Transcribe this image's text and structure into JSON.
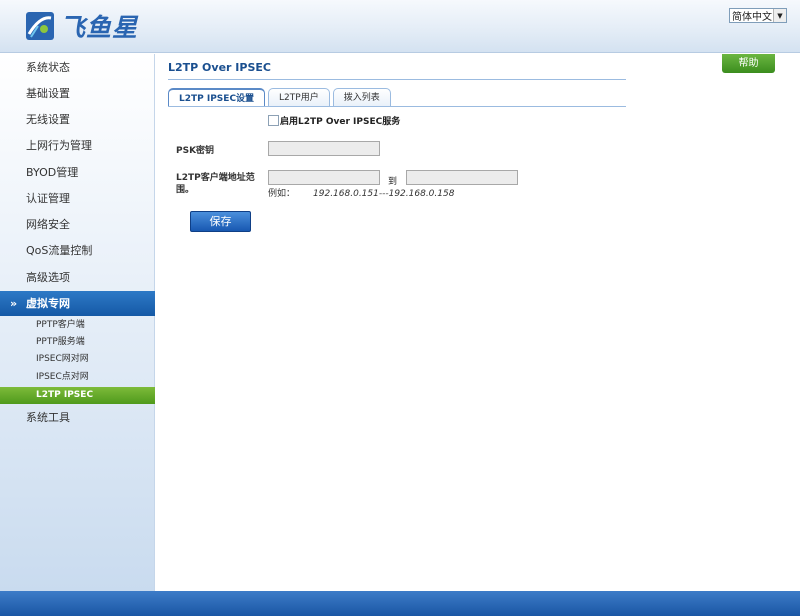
{
  "header": {
    "brand": "飞鱼星",
    "language": "简体中文"
  },
  "sidebar": {
    "items_top": [
      {
        "label": "系统状态"
      },
      {
        "label": "基础设置"
      },
      {
        "label": "无线设置"
      },
      {
        "label": "上网行为管理"
      },
      {
        "label": "BYOD管理"
      },
      {
        "label": "认证管理"
      },
      {
        "label": "网络安全"
      },
      {
        "label": "QoS流量控制"
      },
      {
        "label": "高级选项"
      }
    ],
    "group": {
      "label": "虚拟专网",
      "icon": "double-chevron-down-icon"
    },
    "sub_items": [
      {
        "label": "PPTP客户端"
      },
      {
        "label": "PPTP服务端"
      },
      {
        "label": "IPSEC网对网"
      },
      {
        "label": "IPSEC点对网"
      },
      {
        "label": "L2TP IPSEC"
      }
    ],
    "active_sub": "L2TP IPSEC",
    "items_bottom": [
      {
        "label": "系统工具"
      }
    ]
  },
  "main": {
    "title": "L2TP Over IPSEC",
    "help_label": "帮助",
    "tabs": [
      {
        "label": "L2TP IPSEC设置",
        "active": true
      },
      {
        "label": "L2TP用户",
        "active": false
      },
      {
        "label": "拨入列表",
        "active": false
      }
    ],
    "enable_label": "启用L2TP Over IPSEC服务",
    "enable_checked": false,
    "psk_label": "PSK密钥",
    "psk_value": "",
    "range_label": "L2TP客户端地址范围。",
    "range_start": "",
    "range_end": "",
    "to_label": "到",
    "example_prefix": "例如：",
    "example_value": "192.168.0.151---192.168.0.158",
    "save_label": "保存"
  },
  "colors": {
    "brand_blue": "#2a65b1",
    "active_green": "#4f9a1c",
    "group_blue": "#1559a6"
  }
}
